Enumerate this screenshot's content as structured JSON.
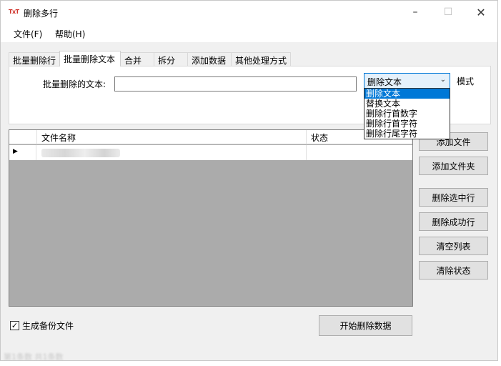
{
  "window": {
    "title": "删除多行",
    "icon_text": "TxT"
  },
  "controls": {
    "minimize": "–",
    "maximize": "☐",
    "close": "✕"
  },
  "menu": {
    "file": "文件(F)",
    "help": "帮助(H)"
  },
  "tabs": [
    "批量删除行",
    "批量删除文本",
    "合并",
    "拆分",
    "添加数据",
    "其他处理方式"
  ],
  "panel": {
    "text_label": "批量删除的文本:",
    "text_value": "",
    "mode_selected": "删除文本",
    "mode_label": "模式"
  },
  "dropdown_options": [
    "删除文本",
    "替换文本",
    "删除行首数字",
    "删除行首字符",
    "删除行尾字符"
  ],
  "grid": {
    "columns": [
      "文件名称",
      "状态"
    ],
    "rows": [
      {
        "status": ""
      }
    ]
  },
  "buttons": {
    "add_file": "添加文件",
    "add_folder": "添加文件夹",
    "delete_selected": "删除选中行",
    "delete_success": "删除成功行",
    "clear_list": "清空列表",
    "clear_status": "清除状态",
    "start": "开始删除数据"
  },
  "backup": {
    "label": "生成备份文件",
    "checked": true
  },
  "status_bar": {
    "text": "第1条数 共1条数"
  },
  "icons": {
    "row_pointer": "triangle-right",
    "check": "checkmark",
    "dropdown": "chevron-down"
  }
}
